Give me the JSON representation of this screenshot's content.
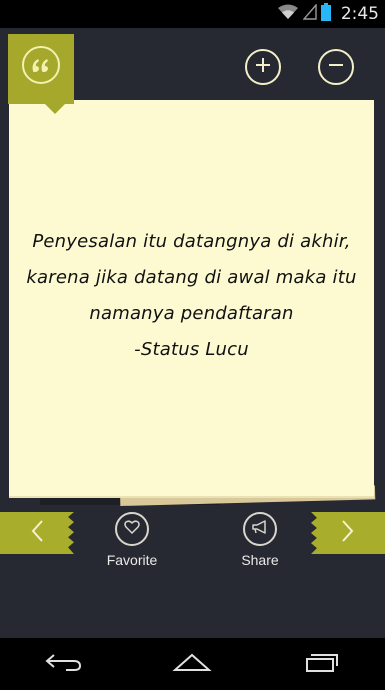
{
  "status_bar": {
    "time": "2:45",
    "icons": [
      "wifi-icon",
      "signal-icon",
      "battery-icon"
    ]
  },
  "quote": {
    "lines": [
      "Penyesalan itu datangnya di akhir,",
      "karena jika datang di awal maka itu",
      "namanya pendaftaran",
      "-Status Lucu"
    ]
  },
  "actions": {
    "favorite_label": "Favorite",
    "share_label": "Share"
  },
  "icons": {
    "quote_badge": "quote-icon",
    "zoom_in": "plus-icon",
    "zoom_out": "minus-icon",
    "prev": "chevron-left-icon",
    "next": "chevron-right-icon",
    "favorite": "heart-icon",
    "share": "megaphone-icon",
    "nav_back": "back-icon",
    "nav_home": "home-icon",
    "nav_recents": "recents-icon"
  },
  "colors": {
    "accent": "#a9ad2c",
    "note": "#fdfad2",
    "background": "#262931"
  }
}
